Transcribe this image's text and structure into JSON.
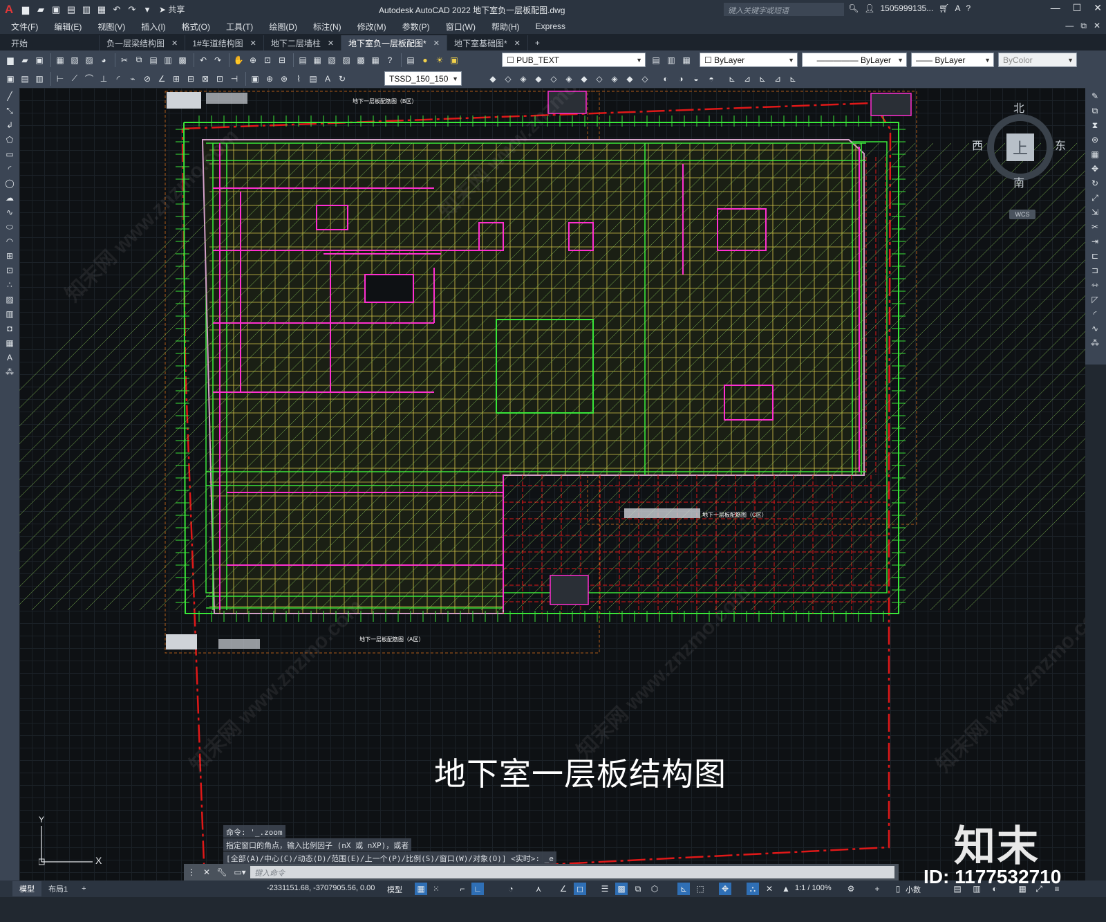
{
  "titlebar": {
    "app_title": "Autodesk AutoCAD 2022    地下室负一层板配图.dwg",
    "share_label": "共享",
    "search_placeholder": "键入关键字或短语",
    "user": "1505999135...",
    "logo": "A"
  },
  "menu": {
    "items": [
      "文件(F)",
      "编辑(E)",
      "视图(V)",
      "插入(I)",
      "格式(O)",
      "工具(T)",
      "绘图(D)",
      "标注(N)",
      "修改(M)",
      "参数(P)",
      "窗口(W)",
      "帮助(H)",
      "Express"
    ]
  },
  "tabs": [
    {
      "label": "开始",
      "closable": false,
      "active": false
    },
    {
      "label": "负一层梁结构图",
      "closable": true,
      "active": false
    },
    {
      "label": "1#车道结构图",
      "closable": true,
      "active": false
    },
    {
      "label": "地下二层墙柱",
      "closable": true,
      "active": false
    },
    {
      "label": "地下室负一层板配图*",
      "closable": true,
      "active": true
    },
    {
      "label": "地下室基础图*",
      "closable": true,
      "active": false
    }
  ],
  "toolbar": {
    "layer_name": "PUB_TEXT",
    "color": "ByLayer",
    "linetype": "ByLayer",
    "lineweight": "ByLayer",
    "plotstyle": "ByColor",
    "dimstyle": "TSSD_150_150"
  },
  "viewcube": {
    "north": "北",
    "south": "南",
    "east": "东",
    "west": "西",
    "face": "上",
    "wcs": "WCS"
  },
  "drawing": {
    "title": "地下室一层板结构图",
    "sub_title_b": "地下一层板配筋图（B区）",
    "sub_title_a": "地下一层板配筋图（A区）",
    "sub_title_c": "地下一层板配筋图（C区）",
    "ucs_y": "Y",
    "ucs_x": "X"
  },
  "command": {
    "history": [
      "命令: '_.zoom",
      "指定窗口的角点，输入比例因子 (nX 或 nXP)，或者",
      "[全部(A)/中心(C)/动态(D)/范围(E)/上一个(P)/比例(S)/窗口(W)/对象(O)] <实时>: _e"
    ],
    "input_placeholder": "键入命令"
  },
  "statusbar": {
    "layouts": [
      "模型",
      "布局1"
    ],
    "coords": "-2331151.68, -3707905.56, 0.00",
    "space": "模型",
    "scale": "1:1 / 100%",
    "units": "小数"
  },
  "watermark": {
    "brand": "知末",
    "id": "ID: 1177532710",
    "site": "知末网 www.znzmo.com"
  },
  "colors": {
    "canvas": "#0e1114",
    "green_lines": "#39e639",
    "magenta_beams": "#ff2fd0",
    "yellow_grid": "#d7c84a",
    "red_axis": "#e01818",
    "accent_blue": "#2f6fb5"
  }
}
